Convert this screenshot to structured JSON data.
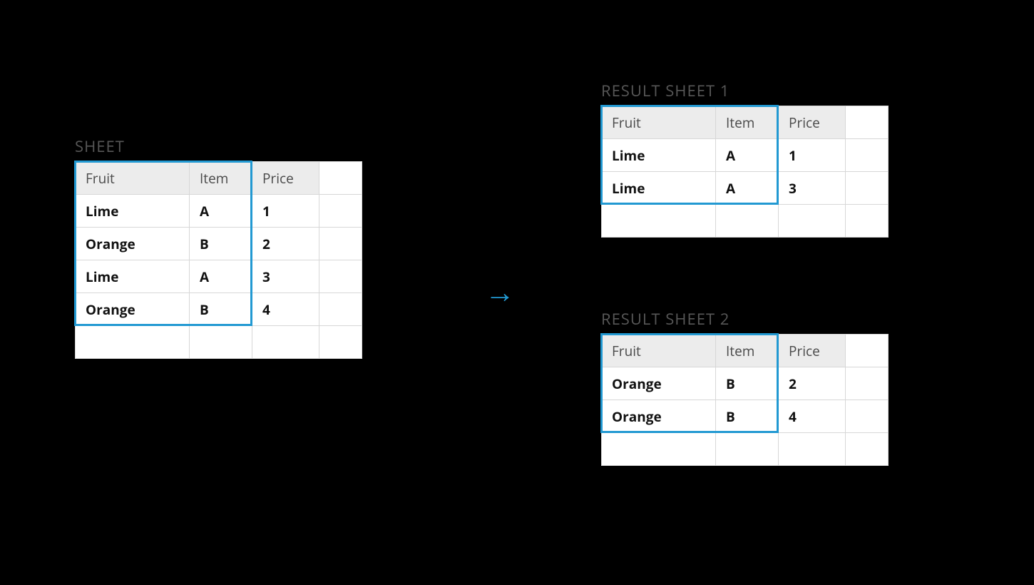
{
  "source": {
    "title": "SHEET",
    "headers": {
      "fruit": "Fruit",
      "item": "Item",
      "price": "Price"
    },
    "rows": [
      {
        "fruit": "Lime",
        "item": "A",
        "price": "1"
      },
      {
        "fruit": "Orange",
        "item": "B",
        "price": "2"
      },
      {
        "fruit": "Lime",
        "item": "A",
        "price": "3"
      },
      {
        "fruit": "Orange",
        "item": "B",
        "price": "4"
      }
    ]
  },
  "result1": {
    "title": "RESULT SHEET 1",
    "headers": {
      "fruit": "Fruit",
      "item": "Item",
      "price": "Price"
    },
    "rows": [
      {
        "fruit": "Lime",
        "item": "A",
        "price": "1"
      },
      {
        "fruit": "Lime",
        "item": "A",
        "price": "3"
      }
    ]
  },
  "result2": {
    "title": "RESULT SHEET 2",
    "headers": {
      "fruit": "Fruit",
      "item": "Item",
      "price": "Price"
    },
    "rows": [
      {
        "fruit": "Orange",
        "item": "B",
        "price": "2"
      },
      {
        "fruit": "Orange",
        "item": "B",
        "price": "4"
      }
    ]
  },
  "arrow_glyph": "→"
}
